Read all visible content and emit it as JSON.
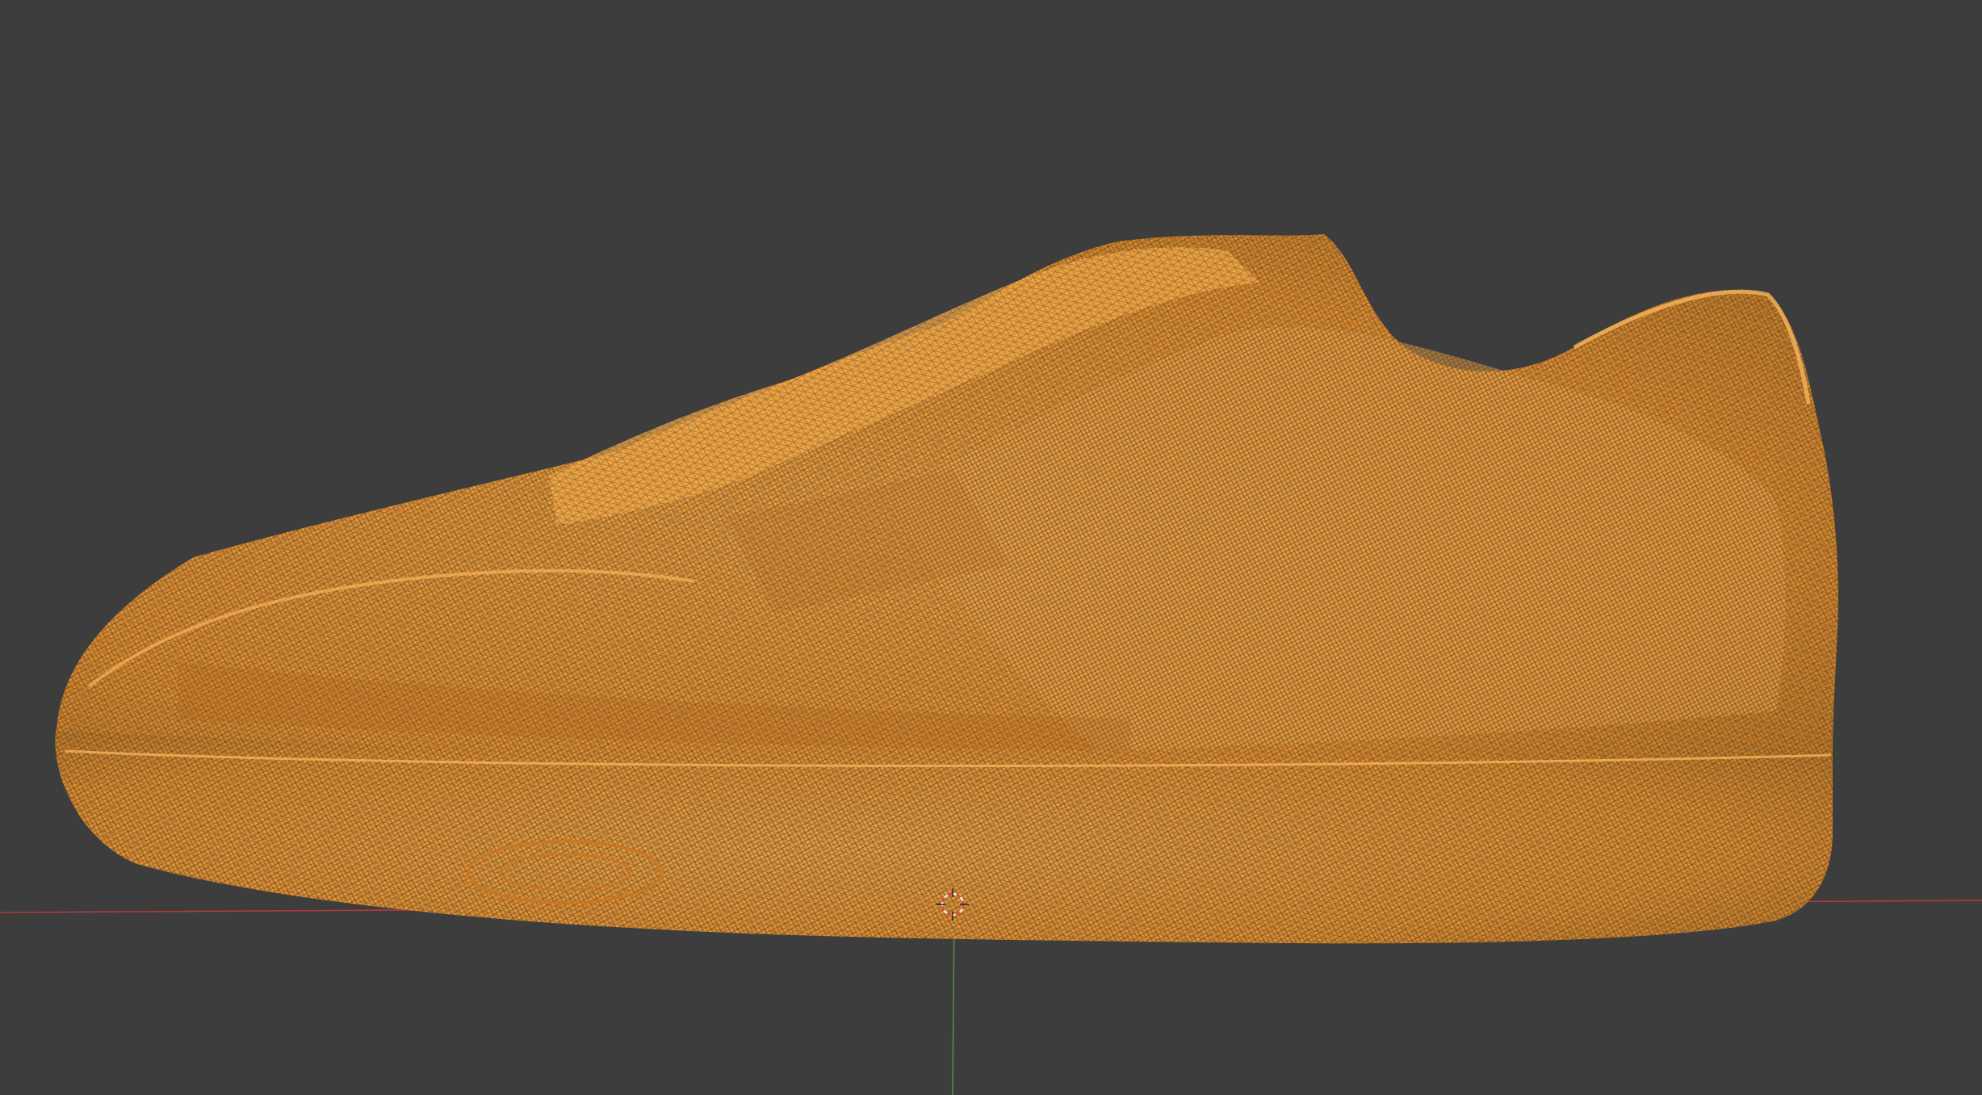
{
  "viewport": {
    "background_color": "#3d3d3d",
    "mesh_color": "#f0982a",
    "mesh_dark_color": "#b86a1a",
    "x_axis_color": "#b03a3a",
    "y_axis_color": "#5a8a3a",
    "selected_object": "shoe-wireframe-mesh",
    "display_mode": "wireframe",
    "cursor_icon": "3d-cursor-icon"
  }
}
